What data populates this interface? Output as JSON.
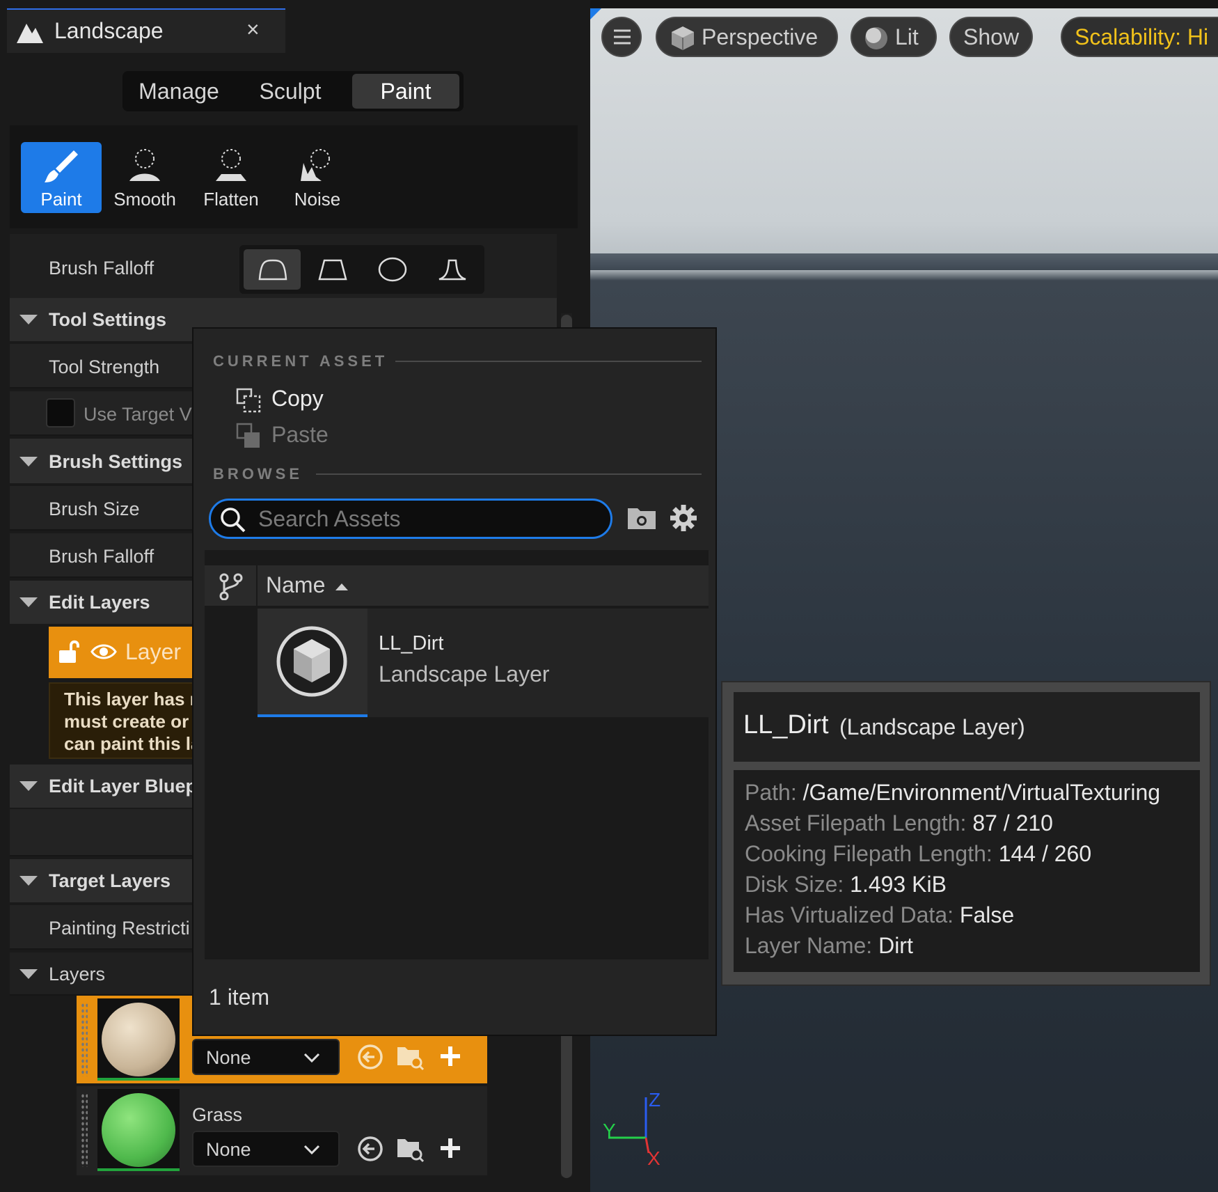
{
  "panel_tab": {
    "title": "Landscape",
    "close": "×"
  },
  "mode_tabs": [
    "Manage",
    "Sculpt",
    "Paint"
  ],
  "tools": [
    "Paint",
    "Smooth",
    "Flatten",
    "Noise"
  ],
  "props": {
    "brush_falloff_top": "Brush Falloff",
    "tool_settings": "Tool Settings",
    "tool_strength": "Tool Strength",
    "use_target_value": "Use Target V",
    "brush_settings": "Brush Settings",
    "brush_size": "Brush Size",
    "brush_falloff": "Brush Falloff",
    "edit_layers": "Edit Layers",
    "layer_name": "Layer",
    "warning": [
      "This layer has r",
      "must create or",
      "can paint this la"
    ],
    "edit_layer_blueprints": "Edit Layer Bluepr",
    "target_layers": "Target Layers",
    "painting_restriction": "Painting Restricti",
    "layers": "Layers"
  },
  "target_layers": [
    {
      "name": "",
      "asset": "None",
      "color": "#d9c8ae"
    },
    {
      "name": "Grass",
      "asset": "None",
      "color": "#58c25a"
    }
  ],
  "viewport": {
    "perspective": "Perspective",
    "lit": "Lit",
    "show": "Show",
    "scalability": "Scalability: Hi",
    "axes": {
      "x": "X",
      "y": "Y",
      "z": "Z"
    }
  },
  "picker": {
    "current_asset_header": "CURRENT ASSET",
    "copy": "Copy",
    "paste": "Paste",
    "browse_header": "BROWSE",
    "search_placeholder": "Search Assets",
    "column_name": "Name",
    "asset_name": "LL_Dirt",
    "asset_type": "Landscape Layer",
    "item_count": "1 item"
  },
  "tooltip": {
    "name": "LL_Dirt",
    "type": "(Landscape Layer)",
    "rows": [
      {
        "k": "Path:",
        "v": "/Game/Environment/VirtualTexturing"
      },
      {
        "k": "Asset Filepath Length:",
        "v": "87 / 210"
      },
      {
        "k": "Cooking Filepath Length:",
        "v": "144 / 260"
      },
      {
        "k": "Disk Size:",
        "v": "1.493 KiB"
      },
      {
        "k": "Has Virtualized Data:",
        "v": "False"
      },
      {
        "k": "Layer Name:",
        "v": "Dirt"
      }
    ]
  },
  "colors": {
    "accent": "#1e7be8",
    "orange": "#e8900f",
    "scalability": "#f2c21a"
  }
}
